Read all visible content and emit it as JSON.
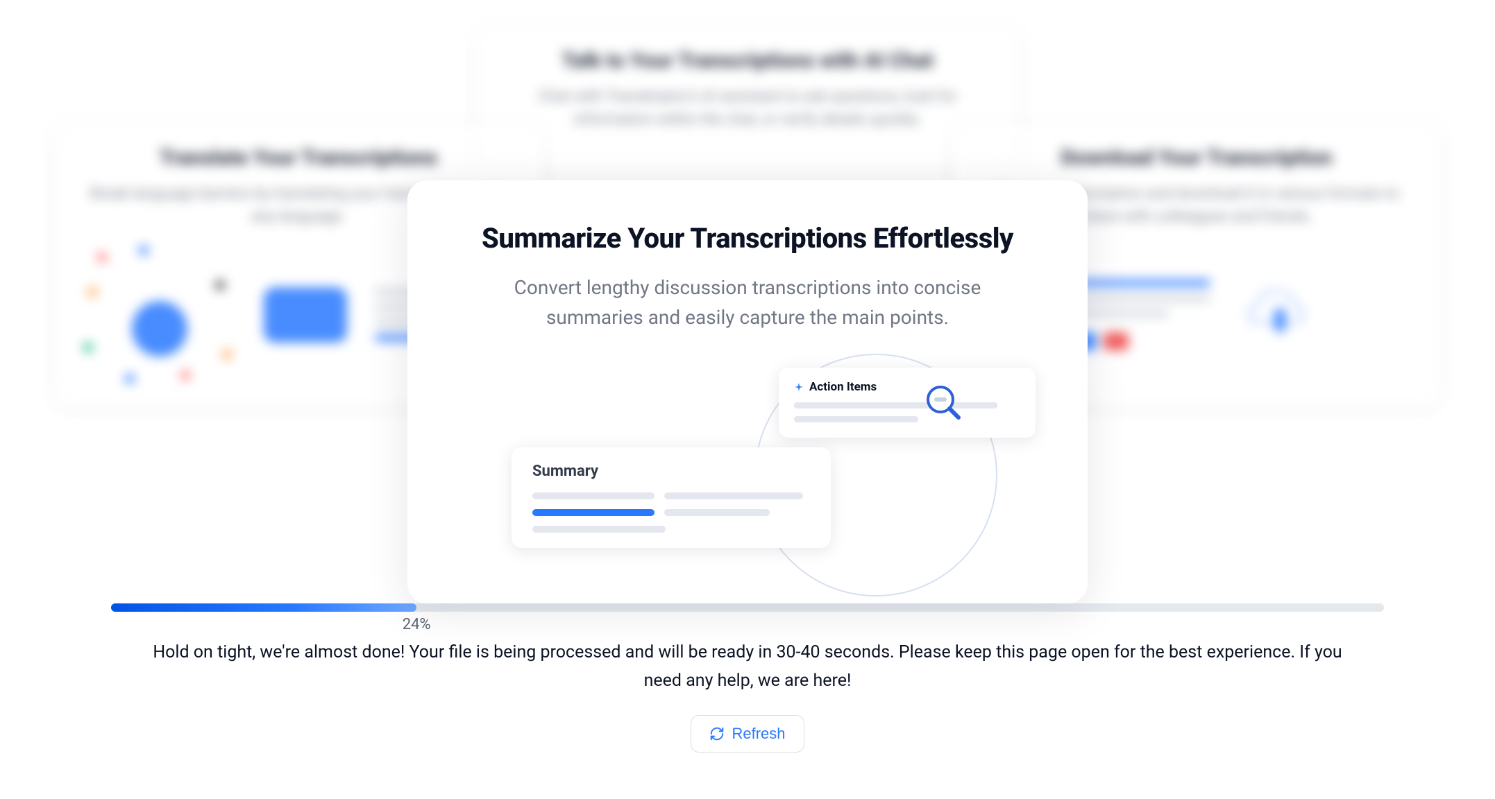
{
  "background_cards": {
    "top": {
      "title": "Talk to Your Transcriptions with AI Chat",
      "desc": "Chat with Transkriptor's AI assistant to ask questions, look for information within the chat, or verify details quickly."
    },
    "left": {
      "title": "Translate Your Transcriptions",
      "desc": "Break language barriers by translating your transcriptions into any language."
    },
    "right": {
      "title": "Download Your Transcription",
      "desc": "Edit your transcription and download it in various formats to share with colleagues and friends."
    }
  },
  "main_card": {
    "title": "Summarize Your Transcriptions Effortlessly",
    "desc": "Convert lengthy discussion transcriptions into concise summaries and easily capture the main points.",
    "action_items_label": "Action Items",
    "summary_label": "Summary"
  },
  "progress": {
    "percent": 24,
    "percent_label": "24%",
    "status_text": "Hold on tight, we're almost done! Your file is being processed and will be ready in 30-40 seconds. Please keep this page open for the best experience. If you need any help, we are here!",
    "refresh_label": "Refresh"
  }
}
